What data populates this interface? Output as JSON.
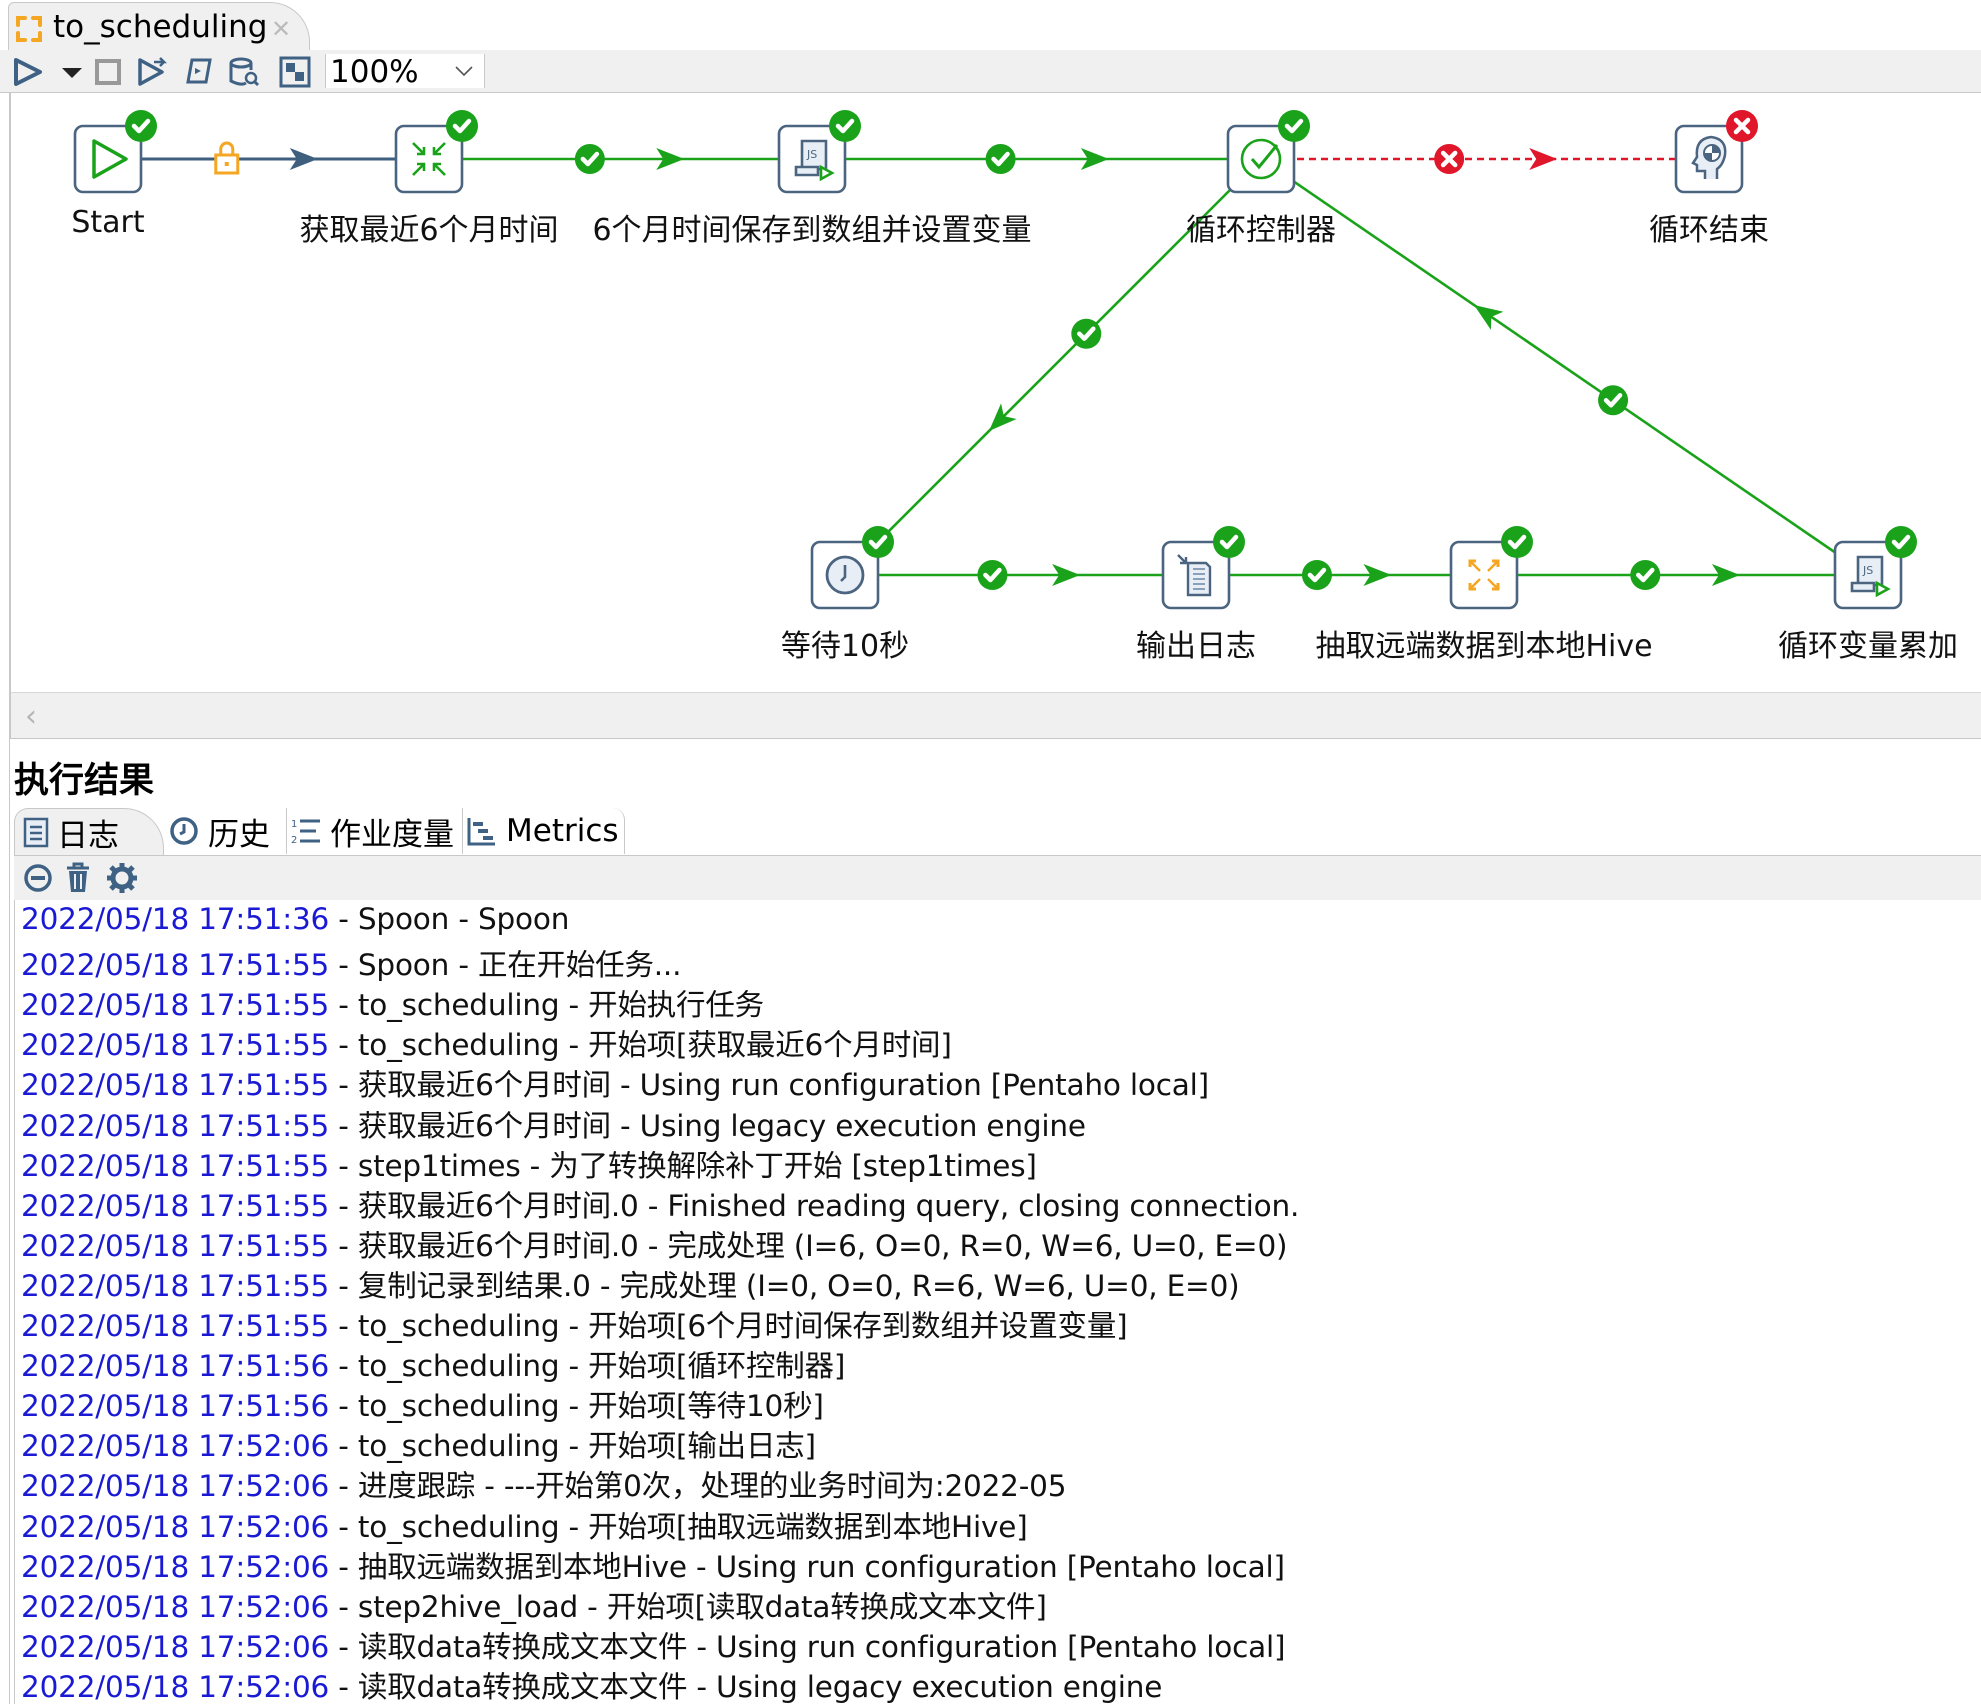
{
  "editor_tab": {
    "title": "to_scheduling",
    "icon": "job-icon",
    "close_icon": "close-icon"
  },
  "toolbar": {
    "buttons": [
      {
        "name": "run",
        "icon": "play-icon"
      },
      {
        "name": "run-options",
        "icon": "dropdown-arrow-icon"
      },
      {
        "name": "stop",
        "icon": "stop-icon"
      },
      {
        "name": "replay",
        "icon": "replay-icon"
      },
      {
        "name": "script",
        "icon": "script-icon"
      },
      {
        "name": "sql",
        "icon": "sql-explore-icon"
      },
      {
        "name": "align",
        "icon": "layout-icon"
      }
    ],
    "zoom_value": "100%"
  },
  "canvas": {
    "nodes": [
      {
        "id": "start",
        "label": "Start",
        "icon": "start-icon",
        "status": "success"
      },
      {
        "id": "get6m",
        "label": "获取最近6个月时间",
        "icon": "transformation-icon",
        "status": "success"
      },
      {
        "id": "js1",
        "label": "6个月时间保存到数组并设置变量",
        "icon": "javascript-icon",
        "status": "success"
      },
      {
        "id": "loopctl",
        "label": "循环控制器",
        "icon": "evaluation-icon",
        "status": "success"
      },
      {
        "id": "loopend",
        "label": "循环结束",
        "icon": "abort-icon",
        "status": "error"
      },
      {
        "id": "wait",
        "label": "等待10秒",
        "icon": "wait-clock-icon",
        "status": "success"
      },
      {
        "id": "writelog",
        "label": "输出日志",
        "icon": "write-log-icon",
        "status": "success"
      },
      {
        "id": "extract",
        "label": "抽取远端数据到本地Hive",
        "icon": "job-icon",
        "status": "success"
      },
      {
        "id": "loopinc",
        "label": "循环变量累加",
        "icon": "javascript-icon",
        "status": "success"
      }
    ],
    "hops": [
      {
        "from": "start",
        "to": "get6m",
        "type": "unconditional"
      },
      {
        "from": "get6m",
        "to": "js1",
        "type": "success"
      },
      {
        "from": "js1",
        "to": "loopctl",
        "type": "success"
      },
      {
        "from": "loopctl",
        "to": "loopend",
        "type": "failure"
      },
      {
        "from": "loopctl",
        "to": "wait",
        "type": "success"
      },
      {
        "from": "wait",
        "to": "writelog",
        "type": "success"
      },
      {
        "from": "writelog",
        "to": "extract",
        "type": "success"
      },
      {
        "from": "extract",
        "to": "loopinc",
        "type": "success"
      },
      {
        "from": "loopinc",
        "to": "loopctl",
        "type": "success"
      }
    ],
    "colors": {
      "success": "#1aa31a",
      "failure": "#e0162b",
      "unconditional": "#3f5f7f",
      "lock": "#f5a623",
      "node_border": "#4b6480"
    }
  },
  "results": {
    "title": "执行结果",
    "tabs": [
      {
        "label": "日志",
        "icon": "log-icon",
        "active": true
      },
      {
        "label": "历史",
        "icon": "history-icon",
        "active": false
      },
      {
        "label": "作业度量",
        "icon": "metrics-list-icon",
        "active": false
      },
      {
        "label": "Metrics",
        "icon": "gantt-icon",
        "active": false
      }
    ],
    "log_toolbar": [
      {
        "name": "clear-log",
        "icon": "minus-circle-icon"
      },
      {
        "name": "delete-log",
        "icon": "trash-icon"
      },
      {
        "name": "log-settings",
        "icon": "gear-icon"
      }
    ],
    "log": [
      {
        "ts": "2022/05/18 17:51:36",
        "msg": " - Spoon - Spoon"
      },
      {
        "ts": "2022/05/18 17:51:55",
        "msg": " - Spoon - 正在开始任务..."
      },
      {
        "ts": "2022/05/18 17:51:55",
        "msg": " - to_scheduling - 开始执行任务"
      },
      {
        "ts": "2022/05/18 17:51:55",
        "msg": " - to_scheduling - 开始项[获取最近6个月时间]"
      },
      {
        "ts": "2022/05/18 17:51:55",
        "msg": " - 获取最近6个月时间 - Using run configuration [Pentaho local]"
      },
      {
        "ts": "2022/05/18 17:51:55",
        "msg": " - 获取最近6个月时间 - Using legacy execution engine"
      },
      {
        "ts": "2022/05/18 17:51:55",
        "msg": " - step1times - 为了转换解除补丁开始  [step1times]"
      },
      {
        "ts": "2022/05/18 17:51:55",
        "msg": " - 获取最近6个月时间.0 - Finished reading query, closing connection."
      },
      {
        "ts": "2022/05/18 17:51:55",
        "msg": " - 获取最近6个月时间.0 - 完成处理 (I=6, O=0, R=0, W=6, U=0, E=0)"
      },
      {
        "ts": "2022/05/18 17:51:55",
        "msg": " - 复制记录到结果.0 - 完成处理 (I=0, O=0, R=6, W=6, U=0, E=0)"
      },
      {
        "ts": "2022/05/18 17:51:55",
        "msg": " - to_scheduling - 开始项[6个月时间保存到数组并设置变量]"
      },
      {
        "ts": "2022/05/18 17:51:56",
        "msg": " - to_scheduling - 开始项[循环控制器]"
      },
      {
        "ts": "2022/05/18 17:51:56",
        "msg": " - to_scheduling - 开始项[等待10秒]"
      },
      {
        "ts": "2022/05/18 17:52:06",
        "msg": " - to_scheduling - 开始项[输出日志]"
      },
      {
        "ts": "2022/05/18 17:52:06",
        "msg": " - 进度跟踪 - ---开始第0次，处理的业务时间为:2022-05"
      },
      {
        "ts": "2022/05/18 17:52:06",
        "msg": " - to_scheduling - 开始项[抽取远端数据到本地Hive]"
      },
      {
        "ts": "2022/05/18 17:52:06",
        "msg": " - 抽取远端数据到本地Hive - Using run configuration [Pentaho local]"
      },
      {
        "ts": "2022/05/18 17:52:06",
        "msg": " - step2hive_load - 开始项[读取data转换成文本文件]"
      },
      {
        "ts": "2022/05/18 17:52:06",
        "msg": " - 读取data转换成文本文件 - Using run configuration [Pentaho local]"
      },
      {
        "ts": "2022/05/18 17:52:06",
        "msg": " - 读取data转换成文本文件 - Using legacy execution engine"
      }
    ]
  }
}
